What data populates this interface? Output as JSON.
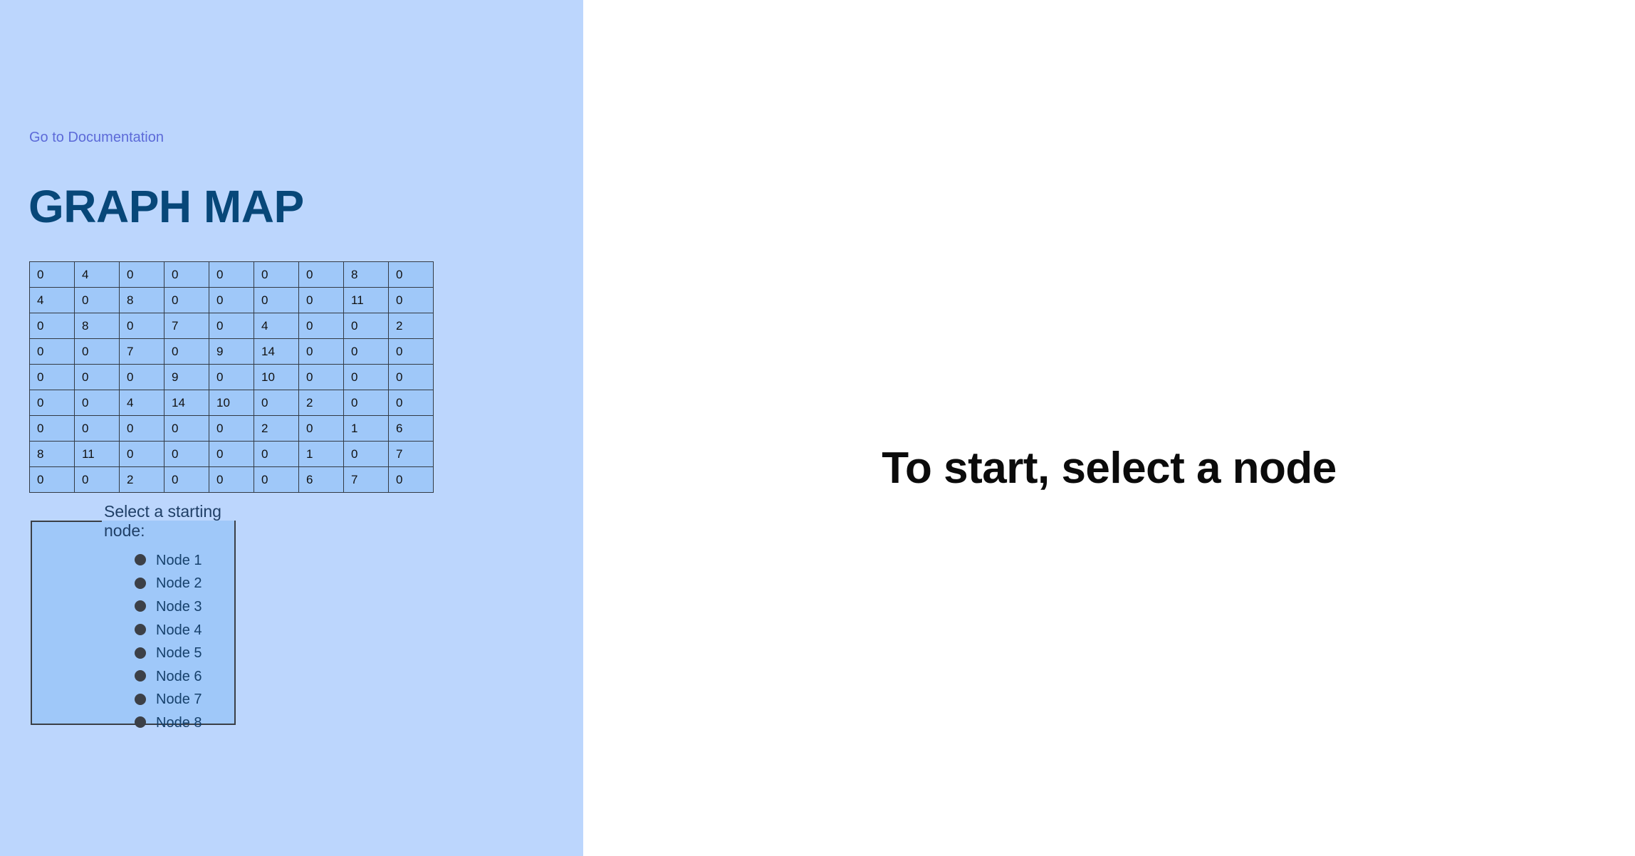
{
  "sidebar": {
    "doc_link": "Go to Documentation",
    "title": "GRAPH MAP",
    "matrix": [
      [
        "0",
        "4",
        "0",
        "0",
        "0",
        "0",
        "0",
        "8",
        "0"
      ],
      [
        "4",
        "0",
        "8",
        "0",
        "0",
        "0",
        "0",
        "11",
        "0"
      ],
      [
        "0",
        "8",
        "0",
        "7",
        "0",
        "4",
        "0",
        "0",
        "2"
      ],
      [
        "0",
        "0",
        "7",
        "0",
        "9",
        "14",
        "0",
        "0",
        "0"
      ],
      [
        "0",
        "0",
        "0",
        "9",
        "0",
        "10",
        "0",
        "0",
        "0"
      ],
      [
        "0",
        "0",
        "4",
        "14",
        "10",
        "0",
        "2",
        "0",
        "0"
      ],
      [
        "0",
        "0",
        "0",
        "0",
        "0",
        "2",
        "0",
        "1",
        "6"
      ],
      [
        "8",
        "11",
        "0",
        "0",
        "0",
        "0",
        "1",
        "0",
        "7"
      ],
      [
        "0",
        "0",
        "2",
        "0",
        "0",
        "0",
        "6",
        "7",
        "0"
      ]
    ],
    "node_select": {
      "legend": "Select a starting node:",
      "options": [
        "Node 1",
        "Node 2",
        "Node 3",
        "Node 4",
        "Node 5",
        "Node 6",
        "Node 7",
        "Node 8"
      ]
    }
  },
  "main": {
    "prompt": "To start, select a node"
  },
  "colors": {
    "sidebar_bg": "#bcd6fd",
    "panel_bg": "#9fc8f9",
    "title": "#074779",
    "link": "#5c6ad8"
  }
}
